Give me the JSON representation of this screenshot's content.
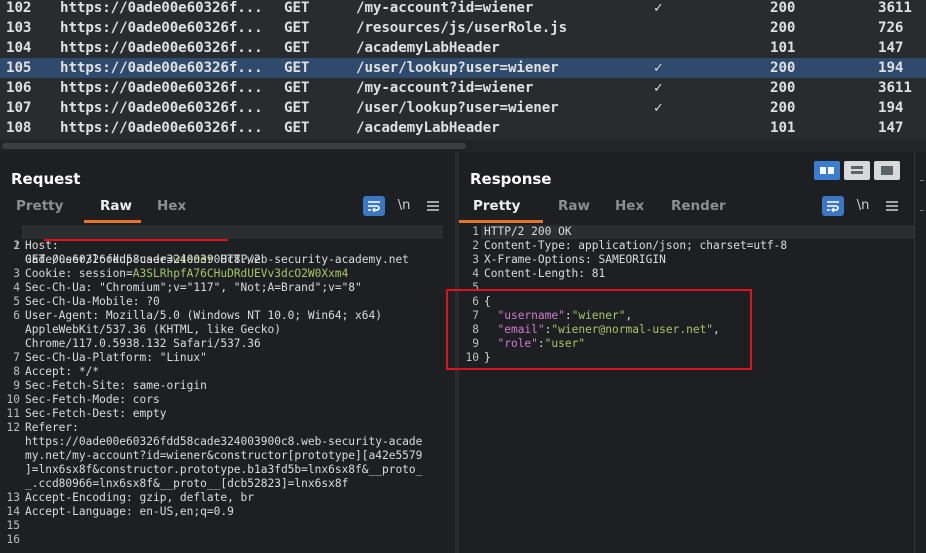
{
  "history": {
    "rows": [
      {
        "num": "102",
        "host": "https://0ade00e60326f...",
        "method": "GET",
        "url": "/my-account?id=wiener",
        "check": "✓",
        "status": "200",
        "length": "3611"
      },
      {
        "num": "103",
        "host": "https://0ade00e60326f...",
        "method": "GET",
        "url": "/resources/js/userRole.js",
        "check": "",
        "status": "200",
        "length": "726"
      },
      {
        "num": "104",
        "host": "https://0ade00e60326f...",
        "method": "GET",
        "url": "/academyLabHeader",
        "check": "",
        "status": "101",
        "length": "147"
      },
      {
        "num": "105",
        "host": "https://0ade00e60326f...",
        "method": "GET",
        "url": "/user/lookup?user=wiener",
        "check": "✓",
        "status": "200",
        "length": "194"
      },
      {
        "num": "106",
        "host": "https://0ade00e60326f...",
        "method": "GET",
        "url": "/my-account?id=wiener",
        "check": "✓",
        "status": "200",
        "length": "3611"
      },
      {
        "num": "107",
        "host": "https://0ade00e60326f...",
        "method": "GET",
        "url": "/user/lookup?user=wiener",
        "check": "✓",
        "status": "200",
        "length": "194"
      },
      {
        "num": "108",
        "host": "https://0ade00e60326f...",
        "method": "GET",
        "url": "/academyLabHeader",
        "check": "",
        "status": "101",
        "length": "147"
      }
    ]
  },
  "request": {
    "title": "Request",
    "tabs": {
      "pretty": "Pretty",
      "raw": "Raw",
      "hex": "Hex"
    },
    "newline_label": "\\n",
    "line_numbers": [
      "1",
      "2",
      "3",
      "4",
      "5",
      "6",
      "7",
      "8",
      "9",
      "10",
      "11",
      "12",
      "13",
      "14",
      "15",
      "16"
    ],
    "lines": {
      "l1_method": "GET ",
      "l1_path": "/user/lookup?user=",
      "l1_user": "wiener",
      "l1_proto": " HTTP/2",
      "l2a": "Host:",
      "l2b": "0ade00e60326fdd58cade324003900c8.web-security-academy.net",
      "l3_key": "Cookie: ",
      "l3_name": "session=",
      "l3_val": "A3SLRhpfA76CHuDRdUEVv3dcO2W0Xxm4",
      "l4": "Sec-Ch-Ua: \"Chromium\";v=\"117\", \"Not;A=Brand\";v=\"8\"",
      "l5": "Sec-Ch-Ua-Mobile: ?0",
      "l6a": "User-Agent: Mozilla/5.0 (Windows NT 10.0; Win64; x64)",
      "l6b": "AppleWebKit/537.36 (KHTML, like Gecko)",
      "l6c": "Chrome/117.0.5938.132 Safari/537.36",
      "l7": "Sec-Ch-Ua-Platform: \"Linux\"",
      "l8": "Accept: */*",
      "l9": "Sec-Fetch-Site: same-origin",
      "l10": "Sec-Fetch-Mode: cors",
      "l11": "Sec-Fetch-Dest: empty",
      "l12a": "Referer:",
      "l12b": "https://0ade00e60326fdd58cade324003900c8.web-security-acade",
      "l12c": "my.net/my-account?id=wiener&constructor[prototype][a42e5579",
      "l12d": "]=lnx6sx8f&constructor.prototype.b1a3fd5b=lnx6sx8f&__proto_",
      "l12e": "_.ccd80966=lnx6sx8f&__proto__[dcb52823]=lnx6sx8f",
      "l13": "Accept-Encoding: gzip, deflate, br",
      "l14": "Accept-Language: en-US,en;q=0.9"
    }
  },
  "response": {
    "title": "Response",
    "tabs": {
      "pretty": "Pretty",
      "raw": "Raw",
      "hex": "Hex",
      "render": "Render"
    },
    "newline_label": "\\n",
    "line_numbers": [
      "1",
      "2",
      "3",
      "4",
      "5",
      "6",
      "7",
      "8",
      "9",
      "10"
    ],
    "lines": {
      "l1": "HTTP/2 200 OK",
      "l2": "Content-Type: application/json; charset=utf-8",
      "l3": "X-Frame-Options: SAMEORIGIN",
      "l4": "Content-Length: 81",
      "l6": "{",
      "l7_key": "\"username\"",
      "l7_val": "\"wiener\"",
      "l8_key": "\"email\"",
      "l8_val": "\"wiener@normal-user.net\"",
      "l9_key": "\"role\"",
      "l9_val": "\"user\"",
      "l10": "}"
    }
  },
  "colors": {
    "accent": "#e8732a",
    "selected_row": "#2e4a6c",
    "highlight": "#e0121d",
    "json_key": "#d07ad0",
    "json_string": "#a4c664"
  }
}
